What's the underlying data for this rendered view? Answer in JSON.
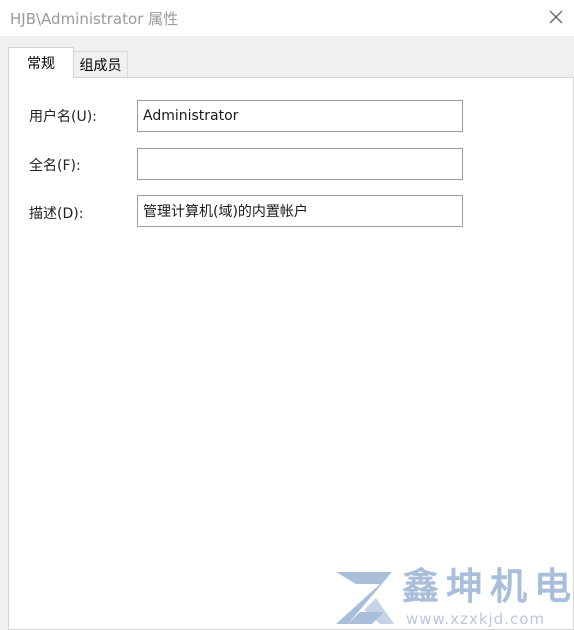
{
  "window": {
    "title": "HJB\\Administrator 属性"
  },
  "tabs": [
    {
      "label": "常规",
      "active": true
    },
    {
      "label": "组成员",
      "active": false
    }
  ],
  "fields": {
    "username": {
      "label": "用户名(U):",
      "value": "Administrator"
    },
    "fullname": {
      "label": "全名(F):",
      "value": ""
    },
    "description": {
      "label": "描述(D):",
      "value": "管理计算机(域)的内置帐户"
    }
  },
  "watermark": {
    "brand": "鑫坤机电",
    "url": "www.xzxkjd.com"
  },
  "colors": {
    "watermark": "#a9bedb",
    "title_text": "#9a9a9a",
    "client_bg": "#f0f0f0",
    "input_border": "#9c9c9c"
  },
  "icons": {
    "close": "close-icon",
    "logo": "xz-logo-icon"
  }
}
